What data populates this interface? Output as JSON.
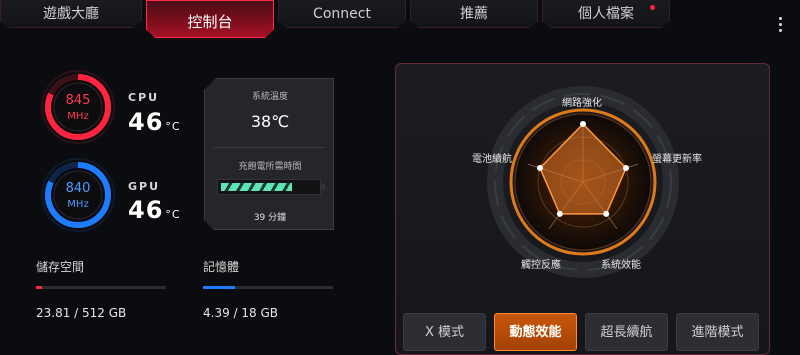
{
  "tabs": [
    {
      "label": "遊戲大廳",
      "active": false
    },
    {
      "label": "控制台",
      "active": true
    },
    {
      "label": "Connect",
      "active": false
    },
    {
      "label": "推薦",
      "active": false
    },
    {
      "label": "個人檔案",
      "active": false,
      "badge": true
    }
  ],
  "cpu": {
    "freq": "845",
    "unit": "MHz",
    "label": "CPU",
    "temp": "46",
    "temp_unit": "°C",
    "color": "#ff2440",
    "level": 0.82
  },
  "gpu": {
    "freq": "840",
    "unit": "MHz",
    "label": "GPU",
    "temp": "46",
    "temp_unit": "°C",
    "color": "#1e7cff",
    "level": 0.82
  },
  "system": {
    "temp_title": "系統溫度",
    "temp_value": "38℃",
    "charge_title": "充飽電所需時間",
    "charge_time": "39 分鐘",
    "battery_level": 0.72
  },
  "storage": {
    "title": "儲存空間",
    "value": "23.81 / 512 GB",
    "usage": 0.046,
    "color": "#ff2440"
  },
  "memory": {
    "title": "記憶體",
    "value": "4.39 / 18 GB",
    "usage": 0.244,
    "color": "#1e7cff"
  },
  "radar": {
    "axes": [
      "網路強化",
      "螢幕更新率",
      "系統效能",
      "觸控反應",
      "電池續航"
    ],
    "values": [
      1.0,
      0.78,
      0.68,
      0.68,
      0.78
    ]
  },
  "modes": [
    {
      "label": "X 模式",
      "active": false
    },
    {
      "label": "動態效能",
      "active": true
    },
    {
      "label": "超長續航",
      "active": false
    },
    {
      "label": "進階模式",
      "active": false
    }
  ],
  "icons": {
    "menu": "more-vertical-icon"
  }
}
